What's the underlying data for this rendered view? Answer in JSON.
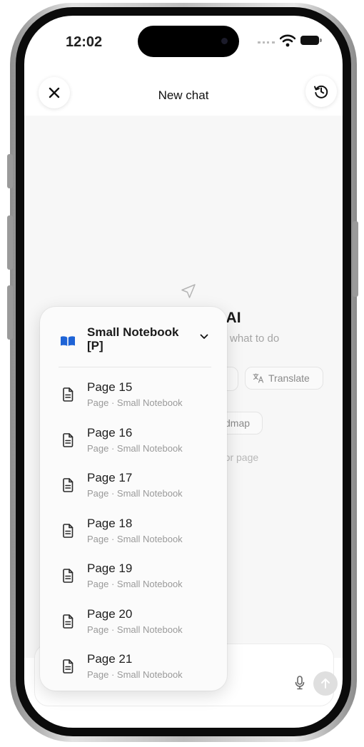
{
  "status_bar": {
    "time": "12:02"
  },
  "header": {
    "title": "New chat"
  },
  "empty_state": {
    "title_partial": "ote AI",
    "subtitle_partial": "what to do",
    "chip_translate": "Translate",
    "chip_mindmap_partial": "dmap",
    "hint_partial": "ok or page"
  },
  "notebook_menu": {
    "selected_notebook": "Small Notebook [P]",
    "pages": [
      {
        "title": "Page 15",
        "subtitle": "Page · Small Notebook"
      },
      {
        "title": "Page 16",
        "subtitle": "Page · Small Notebook"
      },
      {
        "title": "Page 17",
        "subtitle": "Page · Small Notebook"
      },
      {
        "title": "Page 18",
        "subtitle": "Page · Small Notebook"
      },
      {
        "title": "Page 19",
        "subtitle": "Page · Small Notebook"
      },
      {
        "title": "Page 20",
        "subtitle": "Page · Small Notebook"
      },
      {
        "title": "Page 21",
        "subtitle": "Page · Small Notebook"
      }
    ]
  },
  "icons": [
    "close-icon",
    "history-icon",
    "navigation-arrow-icon",
    "translate-icon",
    "book-icon",
    "chevron-down-icon",
    "document-icon",
    "microphone-icon",
    "send-arrow-icon",
    "wifi-icon",
    "battery-icon"
  ],
  "colors": {
    "accent_blue": "#1e63d6",
    "background": "#f7f7f7",
    "text_primary": "#1f1f1f",
    "text_secondary": "#9a9a9a"
  }
}
